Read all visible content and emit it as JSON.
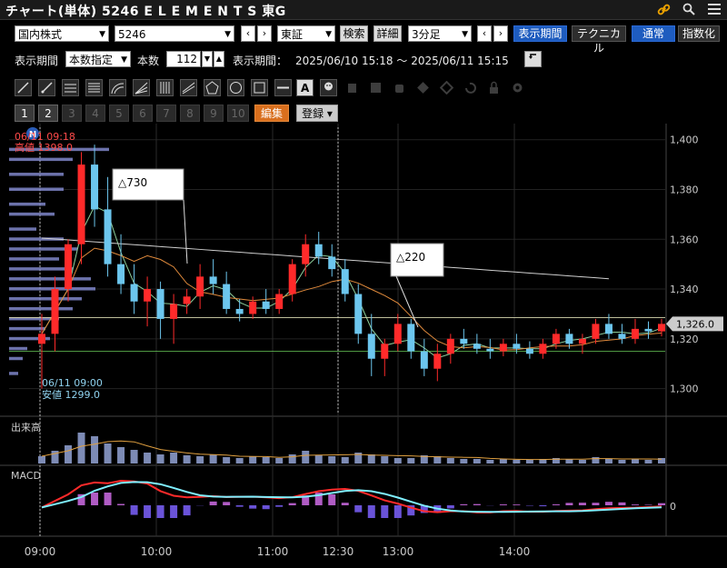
{
  "window": {
    "title": "チャート(単体) 5246 E L E M E N T S 東G"
  },
  "toolbar": {
    "market_select": "国内株式",
    "code_input": "5246",
    "exchange_select": "東証",
    "search_label": "検索",
    "detail_label": "詳細",
    "interval_select": "3分足",
    "show_period_label": "表示期間",
    "technical_label": "テクニカル",
    "normal_label": "通常",
    "index_label": "指数化"
  },
  "period": {
    "label": "表示期間",
    "mode_select": "本数指定",
    "count_label": "本数",
    "count_value": "112",
    "range_label": "表示期間：",
    "range_value": "2025/06/10 15:18 ～ 2025/06/11 15:15"
  },
  "tabs": {
    "numbers": [
      "1",
      "2",
      "3",
      "4",
      "5",
      "6",
      "7",
      "8",
      "9",
      "10"
    ],
    "edit_label": "編集",
    "register_label": "登録"
  },
  "chart_data": {
    "type": "candlestick",
    "price_axis": {
      "ylim": [
        1290,
        1405
      ],
      "ticks": [
        "1,400",
        "1,380",
        "1,360",
        "1,340",
        "1,320",
        "1,300"
      ]
    },
    "time_labels": [
      "09:00",
      "10:00",
      "11:00",
      "12:30",
      "13:00",
      "14:00"
    ],
    "last_price": "1,326.0",
    "high_marker": {
      "badge": "N",
      "time": "06/11 09:18",
      "text": "高値 1398.0"
    },
    "low_marker": {
      "time": "06/11 09:00",
      "text": "安値 1299.0"
    },
    "annotations": [
      "△730",
      "△220"
    ],
    "panel_labels": {
      "volume": "出来高",
      "macd": "MACD"
    },
    "macd_zero": "0",
    "candles": [
      [
        1318,
        1330,
        1300,
        1322
      ],
      [
        1322,
        1345,
        1315,
        1340
      ],
      [
        1340,
        1360,
        1335,
        1358
      ],
      [
        1358,
        1395,
        1350,
        1390
      ],
      [
        1390,
        1398,
        1365,
        1372
      ],
      [
        1372,
        1385,
        1345,
        1350
      ],
      [
        1350,
        1362,
        1338,
        1342
      ],
      [
        1342,
        1350,
        1330,
        1335
      ],
      [
        1335,
        1345,
        1325,
        1340
      ],
      [
        1340,
        1343,
        1320,
        1328
      ],
      [
        1328,
        1338,
        1318,
        1334
      ],
      [
        1334,
        1340,
        1330,
        1337
      ],
      [
        1337,
        1350,
        1332,
        1345
      ],
      [
        1345,
        1352,
        1338,
        1342
      ],
      [
        1342,
        1347,
        1330,
        1332
      ],
      [
        1332,
        1336,
        1327,
        1330
      ],
      [
        1330,
        1337,
        1328,
        1335
      ],
      [
        1335,
        1340,
        1330,
        1332
      ],
      [
        1332,
        1340,
        1330,
        1338
      ],
      [
        1338,
        1352,
        1335,
        1350
      ],
      [
        1350,
        1362,
        1345,
        1358
      ],
      [
        1358,
        1363,
        1350,
        1353
      ],
      [
        1353,
        1358,
        1345,
        1348
      ],
      [
        1348,
        1352,
        1335,
        1338
      ],
      [
        1338,
        1342,
        1318,
        1322
      ],
      [
        1322,
        1330,
        1305,
        1312
      ],
      [
        1312,
        1320,
        1305,
        1318
      ],
      [
        1318,
        1330,
        1315,
        1326
      ],
      [
        1326,
        1328,
        1312,
        1315
      ],
      [
        1315,
        1320,
        1305,
        1308
      ],
      [
        1308,
        1318,
        1303,
        1314
      ],
      [
        1314,
        1322,
        1310,
        1320
      ],
      [
        1320,
        1324,
        1316,
        1318
      ],
      [
        1318,
        1322,
        1314,
        1316
      ],
      [
        1316,
        1320,
        1312,
        1315
      ],
      [
        1315,
        1320,
        1313,
        1318
      ],
      [
        1318,
        1322,
        1314,
        1316
      ],
      [
        1316,
        1319,
        1312,
        1314
      ],
      [
        1314,
        1320,
        1312,
        1318
      ],
      [
        1318,
        1324,
        1316,
        1322
      ],
      [
        1322,
        1324,
        1316,
        1318
      ],
      [
        1318,
        1322,
        1314,
        1320
      ],
      [
        1320,
        1328,
        1318,
        1326
      ],
      [
        1326,
        1330,
        1320,
        1322
      ],
      [
        1322,
        1326,
        1318,
        1320
      ],
      [
        1320,
        1328,
        1318,
        1324
      ],
      [
        1324,
        1327,
        1320,
        1323
      ],
      [
        1323,
        1328,
        1321,
        1326
      ]
    ]
  }
}
